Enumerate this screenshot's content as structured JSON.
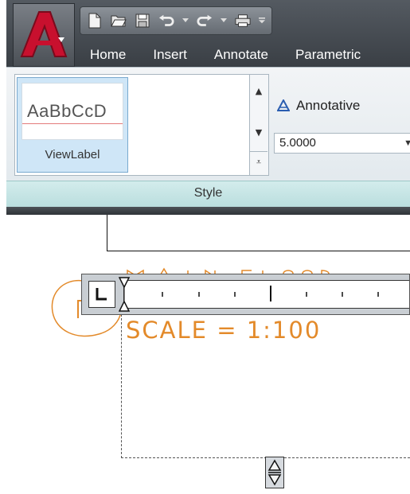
{
  "app": {
    "logo_letter": "A",
    "accent_color": "#c8102e"
  },
  "quick_access": {
    "icons": [
      "new-icon",
      "open-icon",
      "save-icon",
      "undo-icon",
      "redo-icon",
      "plot-icon",
      "customize-dropdown-icon"
    ]
  },
  "tabs": [
    {
      "label": "Home"
    },
    {
      "label": "Insert"
    },
    {
      "label": "Annotate"
    },
    {
      "label": "Parametric"
    }
  ],
  "style_panel": {
    "gallery_item": {
      "preview_text": "AaBbCcD",
      "name": "ViewLabel"
    },
    "annotative_label": "Annotative",
    "scale_value": "5.0000",
    "panel_title": "Style"
  },
  "drawing": {
    "text_color": "#e38a2a"
  }
}
